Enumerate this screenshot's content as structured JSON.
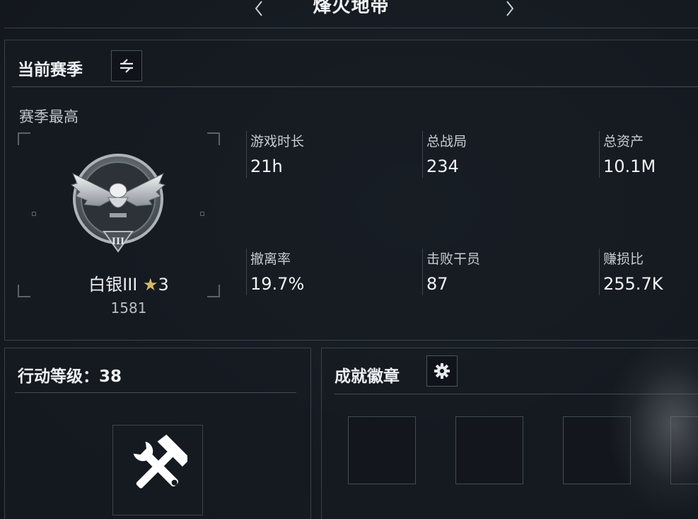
{
  "nav": {
    "title": "烽火地带"
  },
  "season": {
    "title": "当前赛季",
    "best_label": "赛季最高",
    "rank": {
      "name": "白银III",
      "star_glyph": "★",
      "stars": "3",
      "score": "1581",
      "tier_numeral": "III"
    },
    "stats": [
      {
        "label": "游戏时长",
        "value": "21h"
      },
      {
        "label": "总战局",
        "value": "234"
      },
      {
        "label": "总资产",
        "value": "10.1M"
      },
      {
        "label": "撤离率",
        "value": "19.7%"
      },
      {
        "label": "击败干员",
        "value": "87"
      },
      {
        "label": "赚损比",
        "value": "255.7K"
      }
    ]
  },
  "level": {
    "title": "行动等级：38"
  },
  "badges": {
    "title": "成就徽章",
    "slots": 4
  },
  "colors": {
    "background": "#161b22",
    "border": "#39414b",
    "accent_gold": "#d4b96b"
  }
}
